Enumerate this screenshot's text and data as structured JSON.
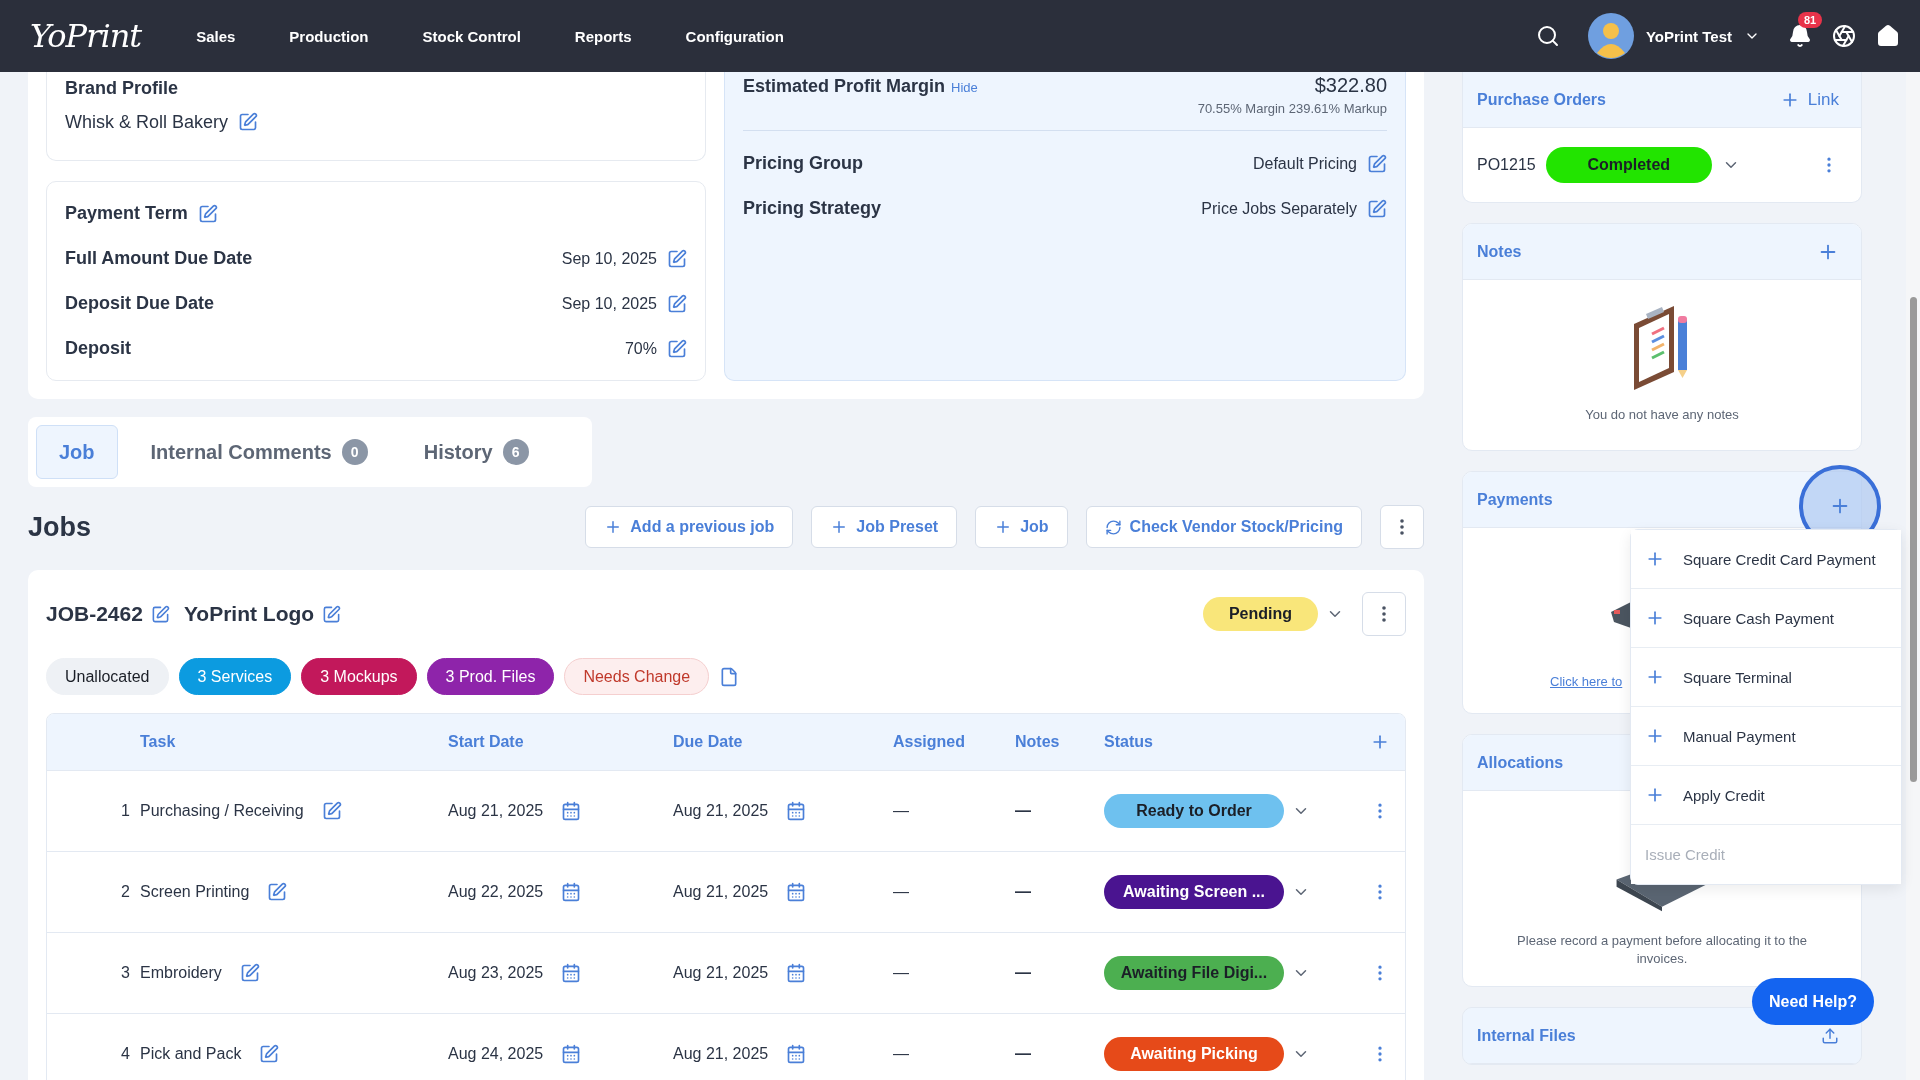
{
  "nav": {
    "logo": "YoPrint",
    "items": [
      "Sales",
      "Production",
      "Stock Control",
      "Reports",
      "Configuration"
    ],
    "user": "YoPrint Test",
    "notification_count": "81"
  },
  "brand_profile": {
    "label": "Brand Profile",
    "value": "Whisk & Roll Bakery"
  },
  "terms": {
    "title": "Payment Term",
    "rows": [
      {
        "label": "Full Amount Due Date",
        "value": "Sep 10, 2025"
      },
      {
        "label": "Deposit Due Date",
        "value": "Sep 10, 2025"
      },
      {
        "label": "Deposit",
        "value": "70%"
      }
    ]
  },
  "profit": {
    "label": "Estimated Profit Margin",
    "link": "Hide",
    "amount": "$322.80",
    "detail": "70.55% Margin 239.61% Markup"
  },
  "pricing": [
    {
      "label": "Pricing Group",
      "value": "Default Pricing"
    },
    {
      "label": "Pricing Strategy",
      "value": "Price Jobs Separately"
    }
  ],
  "tabs": [
    {
      "label": "Job",
      "selected": true
    },
    {
      "label": "Internal Comments",
      "count": "0",
      "selected": false
    },
    {
      "label": "History",
      "count": "6",
      "selected": false
    }
  ],
  "jobs": {
    "title": "Jobs",
    "actions": [
      {
        "label": "Add a previous job",
        "kind": "add"
      },
      {
        "label": "Job Preset",
        "kind": "add"
      },
      {
        "label": "Job",
        "kind": "add"
      },
      {
        "label": "Check Vendor Stock/Pricing",
        "kind": "sync"
      }
    ]
  },
  "job": {
    "code": "JOB-2462",
    "name": "YoPrint Logo",
    "status": {
      "label": "Pending",
      "color": "#f9e67a"
    },
    "chips": [
      {
        "label": "Unallocated",
        "kind": "filled",
        "color": "#eef1f5"
      },
      {
        "label": "3 Services",
        "kind": "filled",
        "color": "#0c9be0"
      },
      {
        "label": "3 Mockups",
        "kind": "filled",
        "color": "#c2185b"
      },
      {
        "label": "3 Prod. Files",
        "kind": "filled",
        "color": "#8e24aa"
      },
      {
        "label": "Needs Change",
        "kind": "outline",
        "color": "#c0392b"
      }
    ],
    "table": {
      "columns": [
        "Task",
        "Start Date",
        "Due Date",
        "Assigned",
        "Notes",
        "Status"
      ],
      "rows": [
        {
          "number": "1",
          "task": "Purchasing / Receiving",
          "start": "Aug 21, 2025",
          "due": "Aug 21, 2025",
          "assigned": "—",
          "notes": "—",
          "status": "Ready to Order",
          "color": "#6ec1ef"
        },
        {
          "number": "2",
          "task": "Screen Printing",
          "start": "Aug 22, 2025",
          "due": "Aug 21, 2025",
          "assigned": "—",
          "notes": "—",
          "status": "Awaiting Screen ...",
          "color": "#4a1490"
        },
        {
          "number": "3",
          "task": "Embroidery",
          "start": "Aug 23, 2025",
          "due": "Aug 21, 2025",
          "assigned": "—",
          "notes": "—",
          "status": "Awaiting File Digi...",
          "color": "#4caf50"
        },
        {
          "number": "4",
          "task": "Pick and Pack",
          "start": "Aug 24, 2025",
          "due": "Aug 21, 2025",
          "assigned": "—",
          "notes": "—",
          "status": "Awaiting Picking",
          "color": "#e64a19"
        }
      ]
    }
  },
  "purchase_orders": {
    "title": "Purchase Orders",
    "link": "Link",
    "orders": [
      {
        "number": "PO1215",
        "status": "Completed",
        "color": "#22e400"
      }
    ]
  },
  "notes": {
    "title": "Notes",
    "empty": "You do not have any notes"
  },
  "payments": {
    "title": "Payments",
    "link": "Click here to",
    "menu": [
      {
        "label": "Square Credit Card Payment",
        "disabled": false
      },
      {
        "label": "Square Cash Payment",
        "disabled": false
      },
      {
        "label": "Square Terminal",
        "disabled": false
      },
      {
        "label": "Manual Payment",
        "disabled": false
      },
      {
        "label": "Apply Credit",
        "disabled": false
      },
      {
        "label": "Issue Credit",
        "disabled": true
      }
    ]
  },
  "allocations": {
    "title": "Allocations",
    "empty": "Please record a payment before allocating it to the invoices."
  },
  "internal_files": {
    "title": "Internal Files"
  },
  "help": "Need Help?"
}
